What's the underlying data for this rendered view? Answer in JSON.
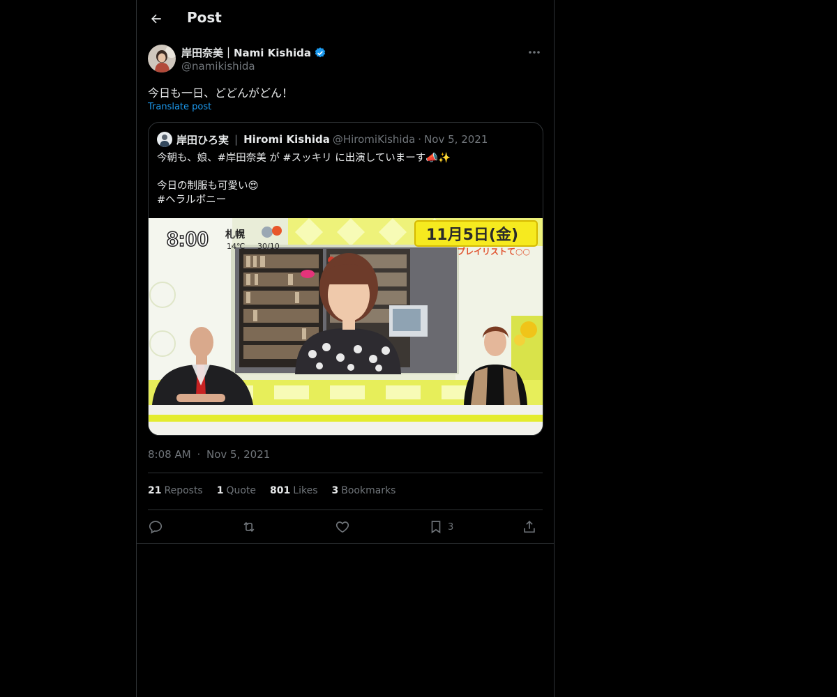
{
  "header": {
    "title": "Post",
    "back_icon": "arrow-left-icon"
  },
  "author": {
    "name": "岸田奈美｜Nami Kishida",
    "handle": "@namikishida",
    "verified_icon": "verified-badge-icon",
    "verified_color": "#1d9bf0"
  },
  "post": {
    "text": "今日も一日、どどんがどん！",
    "translate_label": "Translate post"
  },
  "quote": {
    "name_jp": "岸田ひろ実",
    "separator": "|",
    "name_en": "Hiromi Kishida",
    "handle": "@HiromiKishida",
    "dot": "·",
    "date": "Nov 5, 2021",
    "line1": "今朝も、娘、#岸田奈美 が #スッキリ に出演していまーす📣✨",
    "line2": "今日の制服も可愛い😍",
    "line3": "#ヘラルボニー",
    "media": {
      "clock": "8:00",
      "city": "札幌",
      "temp": "14℃",
      "rain": "30/10",
      "date_banner": "11月5日(金)",
      "sub_banner": "プレイリストて○○"
    }
  },
  "meta": {
    "time": "8:08 AM",
    "dot": "·",
    "date": "Nov 5, 2021"
  },
  "stats": {
    "reposts_count": "21",
    "reposts_label": "Reposts",
    "quote_count": "1",
    "quote_label": "Quote",
    "likes_count": "801",
    "likes_label": "Likes",
    "bookmarks_count": "3",
    "bookmarks_label": "Bookmarks"
  },
  "actions": {
    "bookmark_count": "3"
  },
  "colors": {
    "background": "#000000",
    "border": "#2f3336",
    "muted": "#71767b",
    "accent": "#1d9bf0",
    "text": "#e7e9ea"
  }
}
